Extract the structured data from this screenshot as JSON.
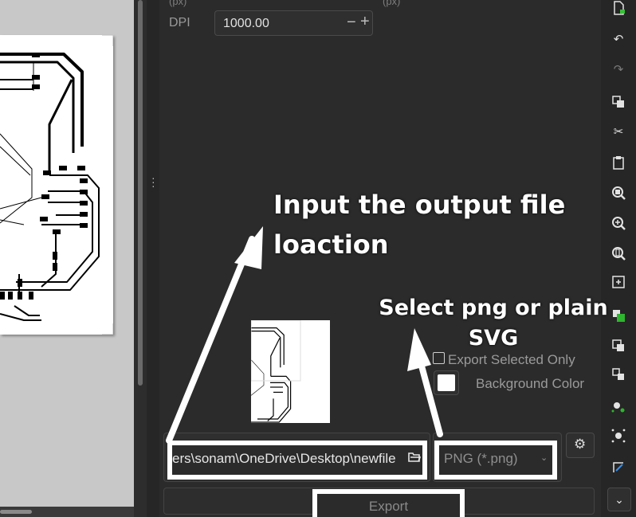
{
  "export_panel": {
    "unit_left": "(px)",
    "unit_right": "(px)",
    "dpi_label": "DPI",
    "dpi_value": "1000.00",
    "dpi_minus": "−",
    "dpi_plus": "+",
    "export_selected_only_label": "Export Selected Only",
    "export_selected_only_checked": false,
    "background_color_label": "Background Color",
    "background_color": "#ffffff",
    "filename_value": "ers\\sonam\\OneDrive\\Desktop\\newfile",
    "format_value": "PNG (*.png)",
    "export_button_label": "Export"
  },
  "annotations": {
    "output_location_note": "Input the output file loaction",
    "format_note": "Select png or plain SVG",
    "highlight_color": "#ffffff"
  },
  "right_toolbar": {
    "icons": [
      "document-import-icon",
      "undo-icon",
      "redo-icon",
      "duplicate-icon",
      "cut-icon",
      "paste-icon",
      "zoom-selection-icon",
      "zoom-drawing-icon",
      "zoom-page-icon",
      "zoom-fit-icon",
      "fill-stroke-icon",
      "group-icon",
      "ungroup-icon",
      "snap-bbox-icon",
      "snap-nodes-icon",
      "xml-editor-icon",
      "more-icon"
    ]
  }
}
